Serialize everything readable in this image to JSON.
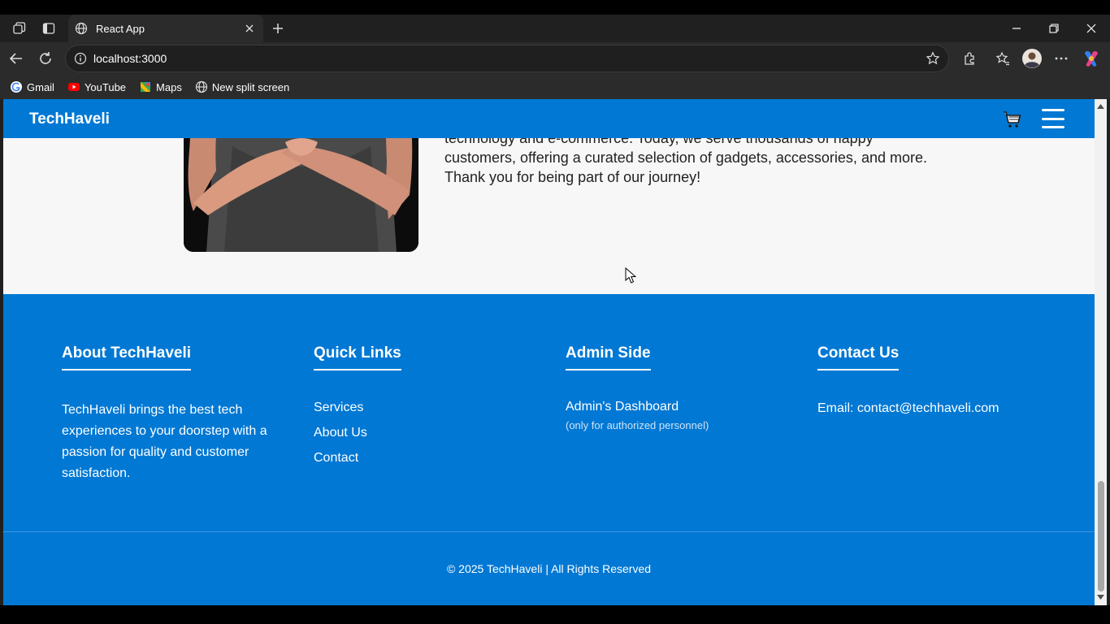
{
  "browser": {
    "tab_title": "React App",
    "url": "localhost:3000",
    "bookmarks": [
      {
        "label": "Gmail",
        "icon": "google-icon"
      },
      {
        "label": "YouTube",
        "icon": "youtube-icon"
      },
      {
        "label": "Maps",
        "icon": "maps-icon"
      },
      {
        "label": "New split screen",
        "icon": "globe-icon"
      }
    ]
  },
  "navbar": {
    "brand": "TechHaveli",
    "cart_icon": "cart-icon",
    "menu_icon": "hamburger-icon",
    "bg_color": "#0078d4"
  },
  "about": {
    "text_cut": "technology and e-commerce. Today, we serve thousands of happy",
    "text_line2": "customers, offering a curated selection of gadgets, accessories, and more.",
    "text_line3": "Thank you for being part of our journey!"
  },
  "footer": {
    "about": {
      "heading": "About TechHaveli",
      "description": "TechHaveli brings the best tech experiences to your doorstep with a passion for quality and customer satisfaction."
    },
    "quick_links": {
      "heading": "Quick Links",
      "links": [
        "Services",
        "About Us",
        "Contact"
      ]
    },
    "admin": {
      "heading": "Admin Side",
      "link": "Admin's Dashboard",
      "note": "(only for authorized personnel)"
    },
    "contact": {
      "heading": "Contact Us",
      "email": "Email: contact@techhaveli.com"
    },
    "copyright": "© 2025 TechHaveli | All Rights Reserved"
  }
}
